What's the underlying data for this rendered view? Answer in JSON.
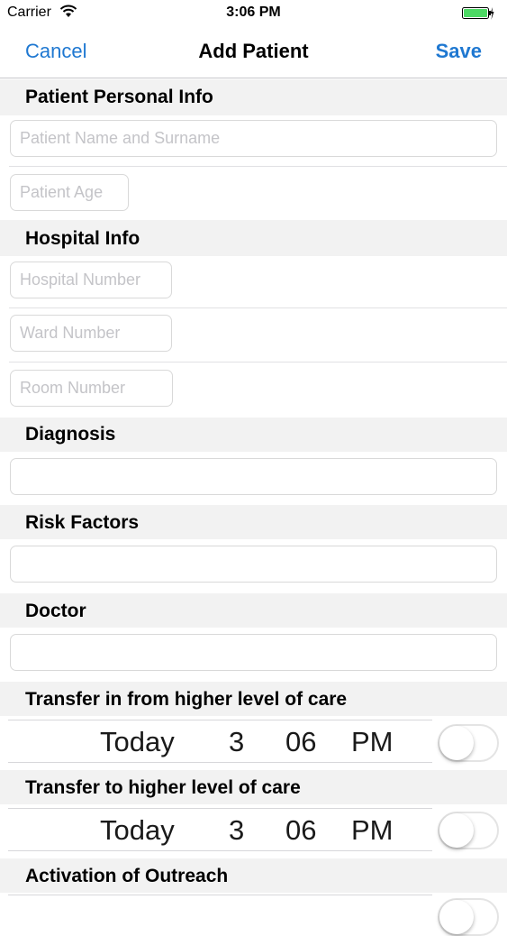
{
  "status_bar": {
    "carrier": "Carrier",
    "time": "3:06 PM"
  },
  "nav": {
    "cancel_label": "Cancel",
    "title": "Add Patient",
    "save_label": "Save"
  },
  "sections": {
    "personal": "Patient Personal Info",
    "hospital": "Hospital Info",
    "diagnosis": "Diagnosis",
    "risk": "Risk Factors",
    "doctor": "Doctor",
    "transfer_in": "Transfer in from higher level of care",
    "transfer_to": "Transfer to higher level of care",
    "outreach": "Activation of Outreach"
  },
  "fields": {
    "name_placeholder": "Patient Name and Surname",
    "age_placeholder": "Patient Age",
    "hospital_number_placeholder": "Hospital Number",
    "ward_number_placeholder": "Ward Number",
    "room_number_placeholder": "Room Number",
    "diagnosis_value": "",
    "risk_value": "",
    "doctor_value": ""
  },
  "pickers": {
    "transfer_in": {
      "day": "Today",
      "hour": "3",
      "minute": "06",
      "ampm": "PM",
      "enabled": false
    },
    "transfer_to": {
      "day": "Today",
      "hour": "3",
      "minute": "06",
      "ampm": "PM",
      "enabled": false
    }
  },
  "colors": {
    "accent": "#1f78d1",
    "battery": "#4cd964"
  }
}
